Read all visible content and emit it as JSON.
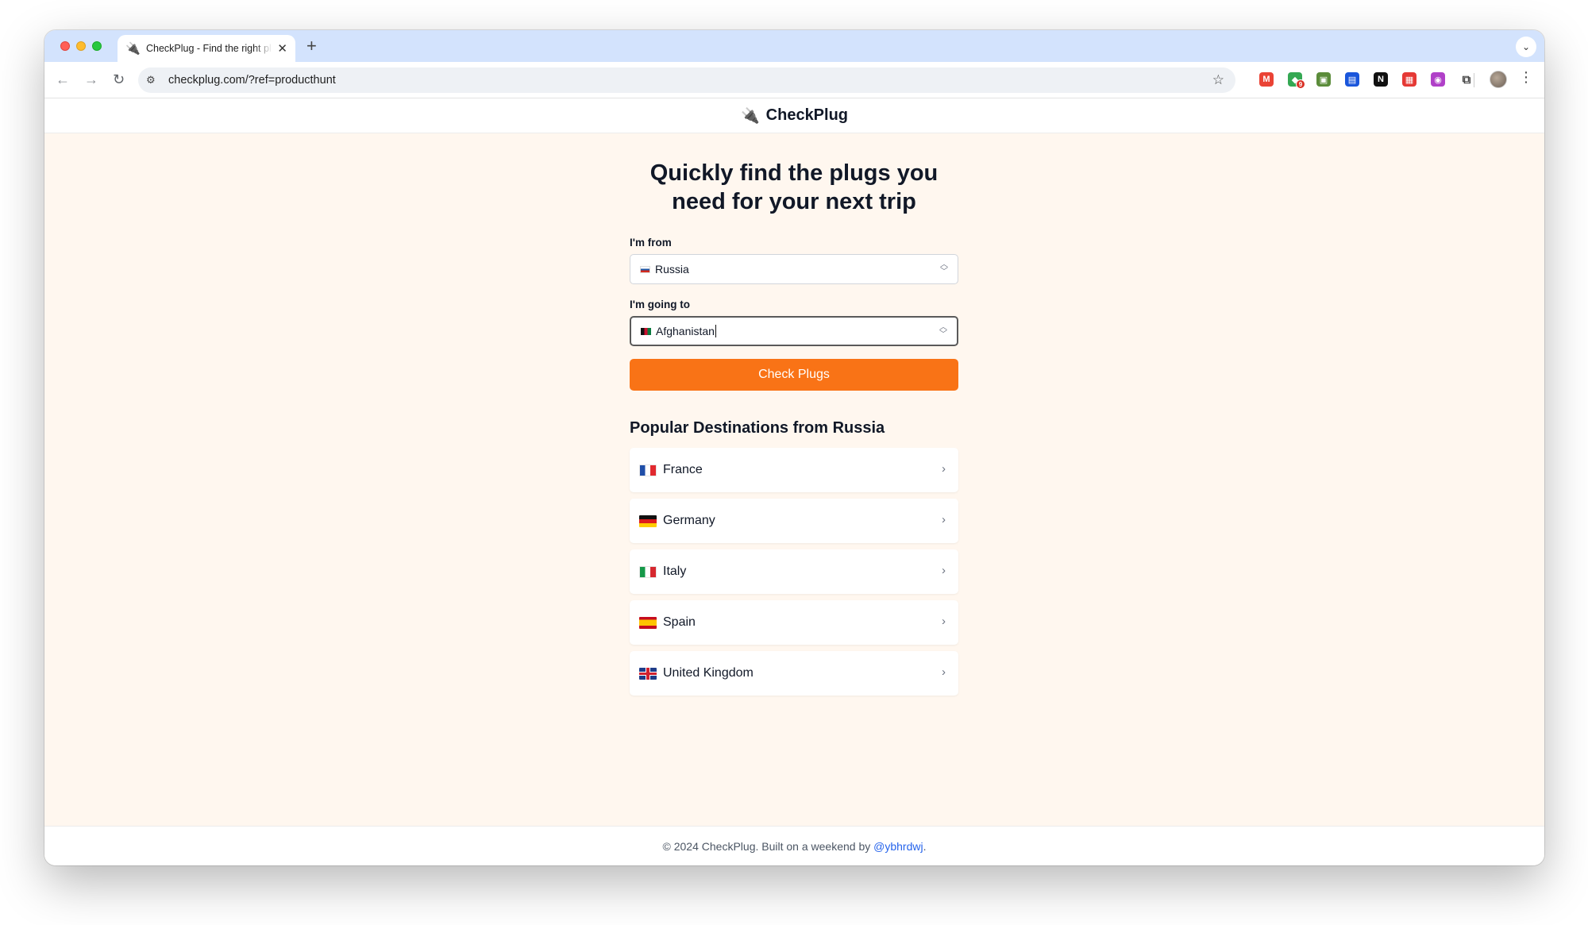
{
  "browser": {
    "tab_title": "CheckPlug - Find the right plugs",
    "tab_favicon": "🔌",
    "url": "checkplug.com/?ref=producthunt",
    "extensions": [
      {
        "name": "gmail-extension-icon",
        "color": "#ea4335",
        "glyph": "M"
      },
      {
        "name": "green-extension-icon",
        "color": "#34a853",
        "glyph": "◆",
        "badge": "9"
      },
      {
        "name": "photo-extension-icon",
        "color": "#5b8c3a",
        "glyph": "▣"
      },
      {
        "name": "blue-extension-icon",
        "color": "#1a56db",
        "glyph": "▤"
      },
      {
        "name": "notion-extension-icon",
        "color": "#111111",
        "glyph": "N"
      },
      {
        "name": "red-extension-icon",
        "color": "#e53935",
        "glyph": "▦"
      },
      {
        "name": "purple-extension-icon",
        "color": "#b040c8",
        "glyph": "◉"
      }
    ]
  },
  "site": {
    "logo_icon": "🔌",
    "name": "CheckPlug"
  },
  "main": {
    "headline": "Quickly find the plugs you need for your next trip",
    "from_label": "I'm from",
    "from_value": "Russia",
    "to_label": "I'm going to",
    "to_value": "Afghanistan",
    "button_label": "Check Plugs",
    "popular_title": "Popular Destinations from Russia",
    "destinations": [
      {
        "name": "France",
        "flag": "fr"
      },
      {
        "name": "Germany",
        "flag": "de"
      },
      {
        "name": "Italy",
        "flag": "it"
      },
      {
        "name": "Spain",
        "flag": "es"
      },
      {
        "name": "United Kingdom",
        "flag": "gb"
      }
    ]
  },
  "footer": {
    "text": "© 2024 CheckPlug. Built on a weekend by ",
    "link": "@ybhrdwj",
    "suffix": "."
  },
  "colors": {
    "accent": "#f97316",
    "page_background": "#fff7ef",
    "link": "#2563eb"
  }
}
